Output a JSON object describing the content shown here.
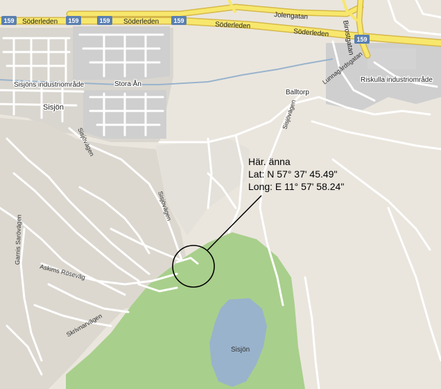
{
  "map": {
    "colors": {
      "land": "#eae6de",
      "built_up": "#d9d6cf",
      "industrial": "#cfcfcf",
      "forest": "#a9cf8c",
      "water": "#99b3cc",
      "road": "#ffffff",
      "highway": "#f7e76d",
      "highway_edge": "#d6b84a",
      "shield": "#5a7fb0",
      "stream": "#99b3cc"
    },
    "places": {
      "sisjons_industriomrade": "Sisjöns industriområde",
      "sisjon": "Sisjön",
      "stora_an": "Stora Ån",
      "balltorp": "Balltorp",
      "riskulla_industriomrade": "Riskulla industriområde",
      "sisjon_lake": "Sisjön"
    },
    "roads": {
      "soderleden": "Söderleden",
      "jolengatan": "Jolengatan",
      "birostgatan": "Birostgatan",
      "lunnagardsgatan": "Lunnagårdsgatan",
      "sisjovagen": "Sisjövägen",
      "garnis_sarovagen": "Garnis Sarövägen",
      "askims_roseväg": "Askims Röseväg",
      "skrivnarvagen": "Skrivnarvägen"
    },
    "shields": {
      "route_number": "159"
    },
    "annotation": {
      "title": "Här. änna",
      "lat": "Lat: N 57° 37' 45.49\"",
      "long": "Long: E 11° 57' 58.24\""
    }
  }
}
